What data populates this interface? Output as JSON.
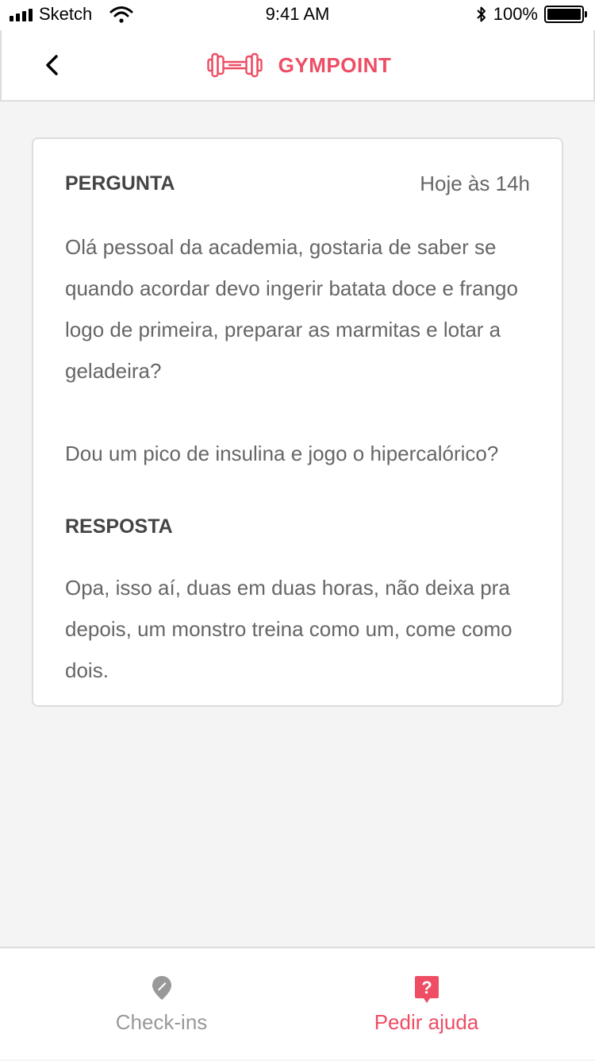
{
  "status_bar": {
    "carrier": "Sketch",
    "time": "9:41 AM",
    "battery": "100%",
    "battery_level": 1.0
  },
  "header": {
    "brand": "GYMPOINT",
    "back_icon": "chevron-left-icon",
    "logo_icon": "dumbbell-icon"
  },
  "card": {
    "question_label": "PERGUNTA",
    "time": "Hoje às 14h",
    "question_paragraphs": [
      "Olá pessoal da academia, gostaria de saber se quando acordar devo ingerir batata doce e frango logo de primeira, preparar as marmitas e lotar a geladeira?",
      "Dou um pico de insulina e jogo o hipercalórico?"
    ],
    "answer_label": "RESPOSTA",
    "answer": "Opa, isso aí, duas em duas horas, não deixa pra depois, um monstro treina como um, come como dois."
  },
  "tabs": [
    {
      "label": "Check-ins",
      "icon": "location-pin-icon",
      "active": false
    },
    {
      "label": "Pedir ajuda",
      "icon": "help-chat-icon",
      "active": true
    }
  ],
  "colors": {
    "accent": "#ee4d64",
    "inactive": "#999999",
    "text": "#666666",
    "heading": "#444444"
  }
}
